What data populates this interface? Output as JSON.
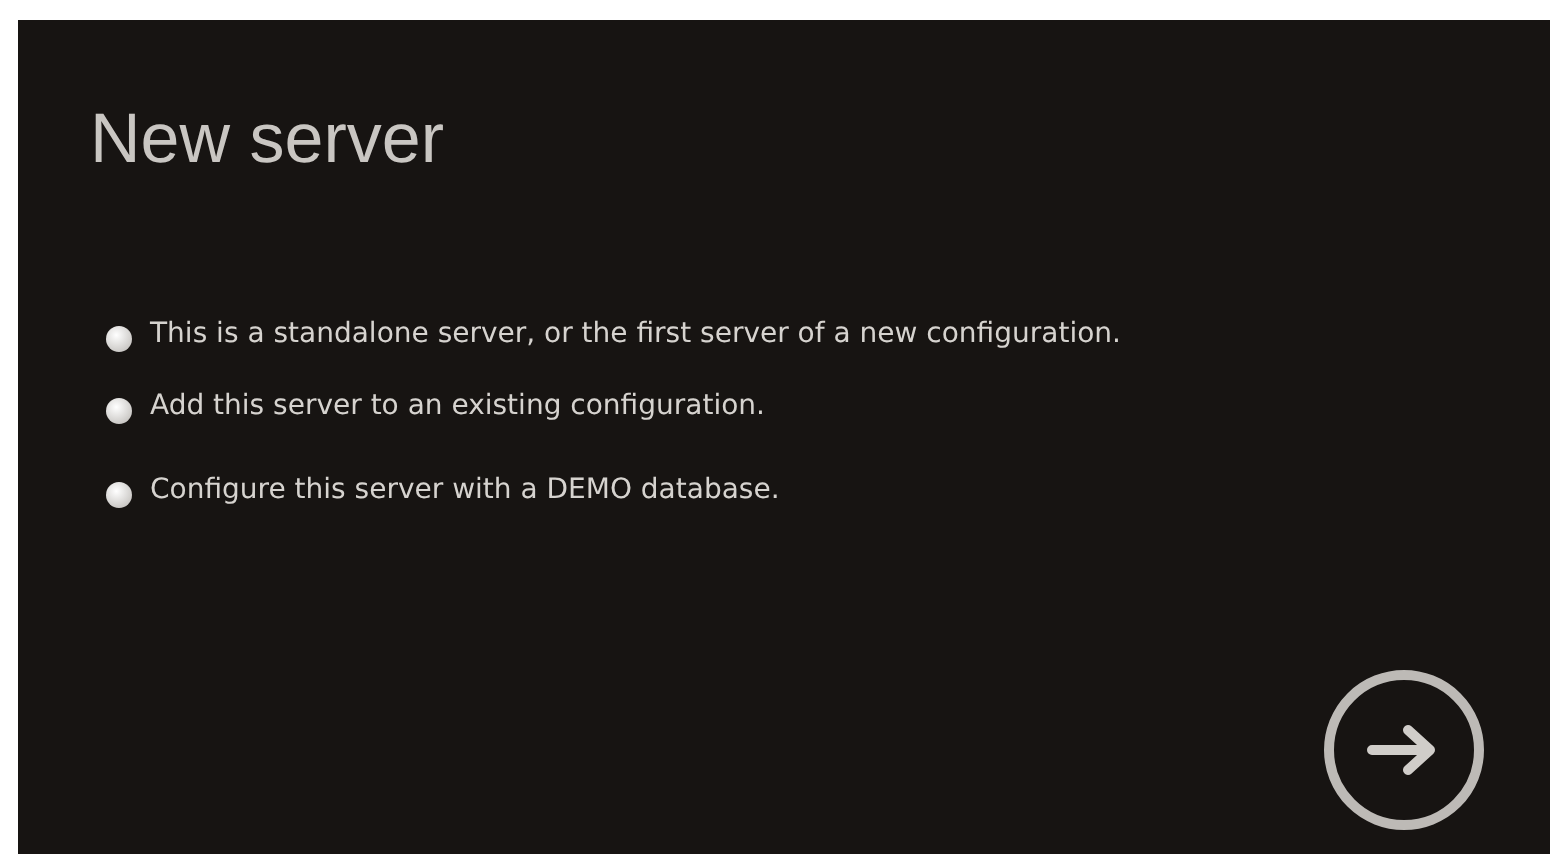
{
  "title": "New server",
  "options": [
    {
      "label": "This is a standalone server, or the first server of a new configuration.",
      "selected": false
    },
    {
      "label": "Add this server to an existing configuration.",
      "selected": false
    },
    {
      "label": "Configure this server with a DEMO database.",
      "selected": false
    }
  ]
}
